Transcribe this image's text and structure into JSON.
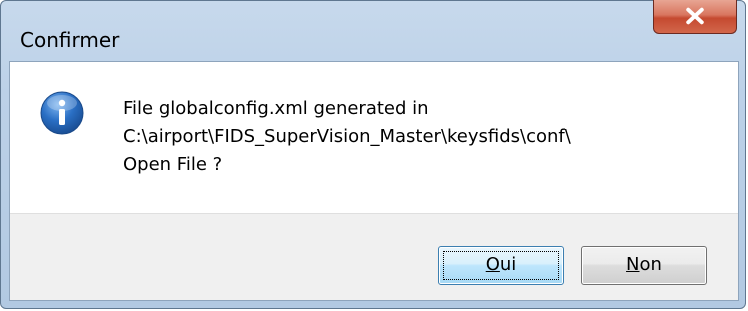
{
  "window": {
    "title": "Confirmer"
  },
  "icons": {
    "info": "info-icon",
    "close": "close-icon"
  },
  "message": {
    "line1": "File globalconfig.xml generated in",
    "line2": "C:\\airport\\FIDS_SuperVision_Master\\keysfids\\conf\\",
    "line3": "Open File ?"
  },
  "buttons": {
    "oui": {
      "mnemonic": "O",
      "rest": "ui"
    },
    "non": {
      "mnemonic": "N",
      "rest": "on"
    }
  },
  "colors": {
    "titlebar": "#bcd1e8",
    "close_button": "#c54a30",
    "info_icon": "#1f5fb0",
    "default_button_border": "#3c7fb1",
    "footer": "#f0f0f0"
  }
}
